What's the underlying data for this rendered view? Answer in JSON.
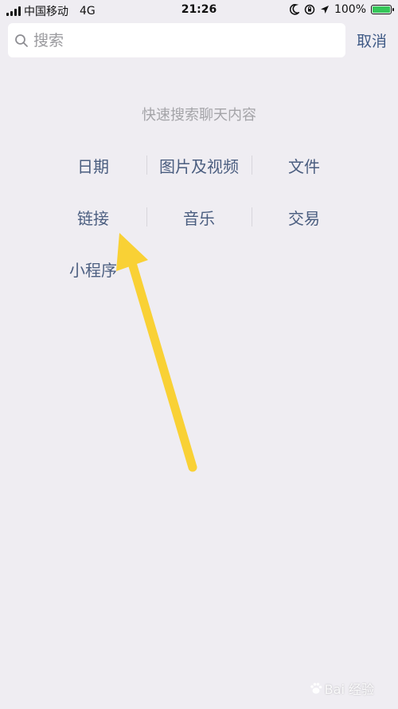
{
  "status_bar": {
    "carrier": "中国移动",
    "network": "4G",
    "time": "21:26",
    "battery_percent": "100%",
    "battery_level": 1.0,
    "battery_color": "#35c759"
  },
  "search": {
    "placeholder": "搜索",
    "cancel_label": "取消"
  },
  "quick_search": {
    "hint": "快速搜索聊天内容",
    "categories": [
      {
        "label": "日期"
      },
      {
        "label": "图片及视频"
      },
      {
        "label": "文件"
      },
      {
        "label": "链接"
      },
      {
        "label": "音乐"
      },
      {
        "label": "交易"
      },
      {
        "label": "小程序"
      }
    ]
  },
  "annotation": {
    "arrow_color": "#f9d135"
  },
  "watermark": {
    "text": "Bai 经验"
  },
  "icons": [
    "signal-icon",
    "moon-icon",
    "lock-rotation-icon",
    "location-icon",
    "battery-icon",
    "search-icon",
    "paw-icon"
  ]
}
